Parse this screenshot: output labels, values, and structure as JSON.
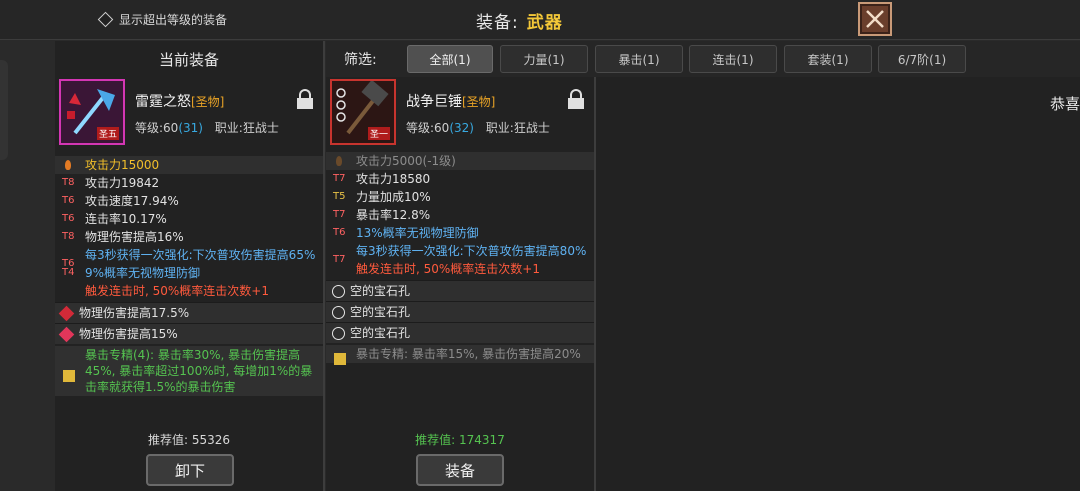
{
  "top": {
    "show_overlevel_label": "显示超出等级的装备",
    "title_label": "装备:",
    "title_value": "武器"
  },
  "left_panel": {
    "header": "当前装备",
    "item": {
      "name": "雷霆之怒",
      "quality": "[圣物]",
      "icon_tag": "圣五",
      "level_label": "等级:60",
      "level_extra": "(31)",
      "class_label": "职业:狂战士"
    },
    "base_stat": "攻击力15000",
    "stats": [
      {
        "tier": "T8",
        "text": "攻击力19842",
        "style": ""
      },
      {
        "tier": "T6",
        "text": "攻击速度17.94%",
        "style": ""
      },
      {
        "tier": "T6",
        "text": "连击率10.17%",
        "style": ""
      },
      {
        "tier": "T8",
        "text": "物理伤害提高16%",
        "style": ""
      },
      {
        "tier": "T6",
        "text": "每3秒获得一次强化:下次普攻伤害提高65%",
        "style": "blue"
      },
      {
        "tier": "T4",
        "text": "9%概率无视物理防御",
        "style": "blue"
      }
    ],
    "special": "触发连击时, 50%概率连击次数+1",
    "gems": [
      "物理伤害提高17.5%",
      "物理伤害提高15%"
    ],
    "set_text": "暴击专精(4): 暴击率30%, 暴击伤害提高45%, 暴击率超过100%时, 每增加1%的暴击率就获得1.5%的暴击伤害",
    "recommend": "推荐值: 55326",
    "button": "卸下"
  },
  "filter": {
    "label": "筛选:",
    "tabs": [
      "全部(1)",
      "力量(1)",
      "暴击(1)",
      "连击(1)",
      "套装(1)",
      "6/7阶(1)"
    ]
  },
  "mid_panel": {
    "item": {
      "name": "战争巨锤",
      "quality": "[圣物]",
      "icon_tag": "圣一",
      "level_label": "等级:60",
      "level_extra": "(32)",
      "class_label": "职业:狂战士"
    },
    "base_stat": "攻击力5000(-1级)",
    "stats": [
      {
        "tier": "T7",
        "text": "攻击力18580",
        "style": ""
      },
      {
        "tier": "T5",
        "text": "力量加成10%",
        "style": ""
      },
      {
        "tier": "T7",
        "text": "暴击率12.8%",
        "style": ""
      },
      {
        "tier": "T6",
        "text": "13%概率无视物理防御",
        "style": "blue"
      },
      {
        "tier": "T7",
        "text": "每3秒获得一次强化:下次普攻伤害提高80%",
        "style": "blue"
      }
    ],
    "special": "触发连击时, 50%概率连击次数+1",
    "sockets": [
      "空的宝石孔",
      "空的宝石孔",
      "空的宝石孔"
    ],
    "set_text": "暴击专精: 暴击率15%, 暴击伤害提高20%",
    "recommend": "推荐值: 174317",
    "button": "装备"
  },
  "right_panel": {
    "text": "恭喜"
  }
}
